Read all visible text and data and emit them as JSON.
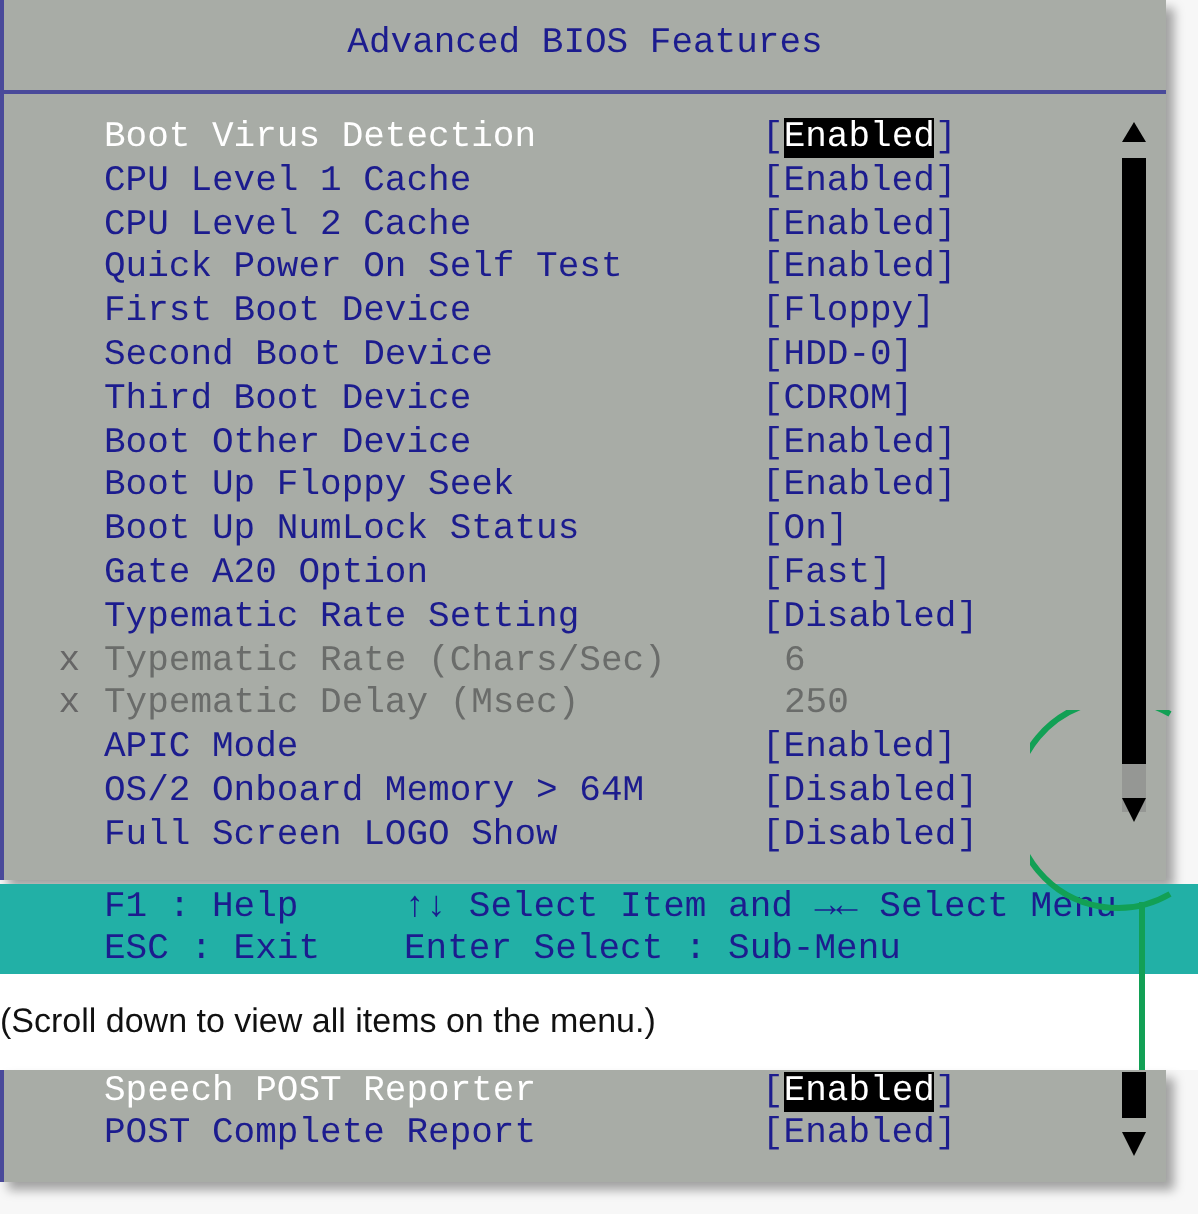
{
  "screen": {
    "title": "Advanced BIOS Features",
    "items": [
      {
        "label": "Boot Virus Detection",
        "value": "[Enabled]",
        "selected": true,
        "disabled": false
      },
      {
        "label": "CPU Level 1 Cache",
        "value": "[Enabled]",
        "selected": false,
        "disabled": false
      },
      {
        "label": "CPU Level 2 Cache",
        "value": "[Enabled]",
        "selected": false,
        "disabled": false
      },
      {
        "label": "Quick Power On Self Test",
        "value": "[Enabled]",
        "selected": false,
        "disabled": false
      },
      {
        "label": "First Boot Device",
        "value": "[Floppy]",
        "selected": false,
        "disabled": false
      },
      {
        "label": "Second Boot Device",
        "value": "[HDD-0]",
        "selected": false,
        "disabled": false
      },
      {
        "label": "Third Boot Device",
        "value": "[CDROM]",
        "selected": false,
        "disabled": false
      },
      {
        "label": "Boot Other Device",
        "value": "[Enabled]",
        "selected": false,
        "disabled": false
      },
      {
        "label": "Boot Up Floppy Seek",
        "value": "[Enabled]",
        "selected": false,
        "disabled": false
      },
      {
        "label": "Boot Up NumLock Status",
        "value": "[On]",
        "selected": false,
        "disabled": false
      },
      {
        "label": "Gate A20 Option",
        "value": "[Fast]",
        "selected": false,
        "disabled": false
      },
      {
        "label": "Typematic Rate Setting",
        "value": "[Disabled]",
        "selected": false,
        "disabled": false
      },
      {
        "marker": "x",
        "label": "Typematic Rate (Chars/Sec)",
        "value": "6",
        "selected": false,
        "disabled": true
      },
      {
        "marker": "x",
        "label": "Typematic Delay (Msec)",
        "value": "250",
        "selected": false,
        "disabled": true
      },
      {
        "label": "APIC Mode",
        "value": "[Enabled]",
        "selected": false,
        "disabled": false
      },
      {
        "label": "OS/2 Onboard Memory > 64M",
        "value": "[Disabled]",
        "selected": false,
        "disabled": false
      },
      {
        "label": "Full Screen LOGO Show",
        "value": "[Disabled]",
        "selected": false,
        "disabled": false
      }
    ]
  },
  "help_bar": [
    {
      "left": "F1  : Help",
      "right": "↑↓ Select Item and →← Select Menu"
    },
    {
      "left": "ESC : Exit",
      "right": "Enter Select : Sub-Menu"
    }
  ],
  "caption": "(Scroll down to view all items on the menu.)",
  "screen_continued": {
    "items": [
      {
        "label": "Speech POST Reporter",
        "value": "[Enabled]",
        "selected": true,
        "disabled": false
      },
      {
        "label": "POST Complete Report",
        "value": "[Enabled]",
        "selected": false,
        "disabled": false
      }
    ]
  }
}
